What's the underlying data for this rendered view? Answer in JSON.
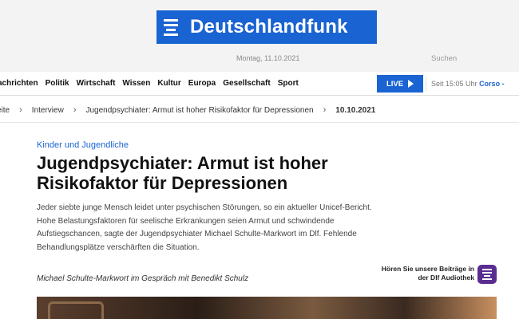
{
  "header": {
    "logo_text": "Deutschlandfunk",
    "logo_icon": "dlf-lines-icon",
    "date": "Montag, 11.10.2021",
    "search_label": "Suchen"
  },
  "nav": {
    "items": [
      "achrichten",
      "Politik",
      "Wirtschaft",
      "Wissen",
      "Kultur",
      "Europa",
      "Gesellschaft",
      "Sport"
    ],
    "live_label": "LIVE",
    "since_prefix": "Seit 15:05 Uhr",
    "since_program": "Corso",
    "since_suffix": "-"
  },
  "breadcrumb": {
    "items": [
      "eite",
      "Interview",
      "Jugendpsychiater: Armut ist hoher Risikofaktor für Depressionen"
    ],
    "date": "10.10.2021"
  },
  "article": {
    "kicker": "Kinder und Jugendliche",
    "headline": "Jugendpsychiater: Armut ist hoher Risikofaktor für Depressionen",
    "teaser": "Jeder siebte junge Mensch leidet unter psychischen Störungen, so ein aktueller Unicef-Bericht. Hohe Belastungsfaktoren für seelische Erkrankungen seien Armut und schwindende Aufstiegschancen, sagte der Jugendpsychiater Michael Schulte-Markwort im Dlf. Fehlende Behandlungsplätze verschärften die Situation.",
    "byline": "Michael Schulte-Markwort im Gespräch mit Benedikt Schulz"
  },
  "audiothek": {
    "text": "Hören Sie unsere Beiträge in der Dlf Audiothek",
    "icon": "audiothek-icon"
  },
  "colors": {
    "brand_blue": "#1a63d3",
    "audiothek_purple": "#5a2d91"
  }
}
